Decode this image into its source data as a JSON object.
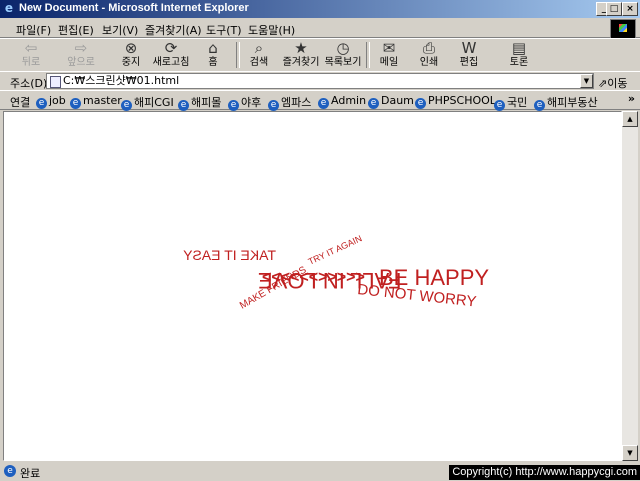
{
  "window": {
    "title": "New Document - Microsoft Internet Explorer",
    "minimize": "_",
    "maximize": "□",
    "close": "×"
  },
  "menu": [
    "파일(F)",
    "편집(E)",
    "보기(V)",
    "즐겨찾기(A)",
    "도구(T)",
    "도움말(H)"
  ],
  "toolbar": {
    "back": "뒤로",
    "forward": "앞으로",
    "stop": "중지",
    "refresh": "새로고침",
    "home": "홈",
    "search": "검색",
    "favorites": "즐겨찾기",
    "history": "목록보기",
    "mail": "메일",
    "print": "인쇄",
    "edit": "편집",
    "discuss": "토론"
  },
  "address": {
    "label": "주소(D)",
    "value": "C:₩스크린샷₩01.html",
    "go": "이동"
  },
  "links": {
    "label": "연결",
    "items": [
      "job",
      "master",
      "해피CGI",
      "해피몰",
      "야후",
      "엠파스",
      "Admin",
      "Daum",
      "PHPSCHOOL",
      "국민",
      "해피부동산"
    ]
  },
  "content": {
    "color": "#c02020",
    "text_left": "FALL IN LOVE",
    "text_take": "TAKE IT EASY",
    "text_friends": "MAKE FRIENDS",
    "text_arrows": "<<<<<<>>>>>",
    "text_try": "TRY IT AGAIN",
    "text_happy": "BE HAPPY",
    "text_worry": "DO NOT WORRY"
  },
  "status": {
    "text": "완료",
    "copyright": "Copyright(c) http://www.happycgi.com"
  }
}
